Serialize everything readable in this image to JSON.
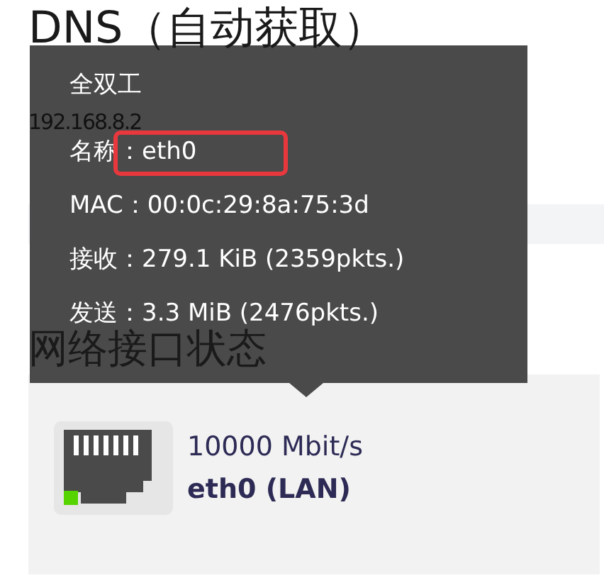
{
  "dns_heading": "DNS（自动获取）",
  "dns_value": "192.168.8.2",
  "section_heading": "网络接口状态",
  "tooltip": {
    "lines": [
      {
        "text": "全双工",
        "highlighted": false
      },
      {
        "text": "名称：eth0",
        "highlighted": true
      },
      {
        "text": "MAC：00:0c:29:8a:75:3d",
        "highlighted": false
      },
      {
        "text": "接收：279.1 KiB (2359pkts.)",
        "highlighted": false
      },
      {
        "text": "发送：3.3 MiB (2476pkts.)",
        "highlighted": false
      }
    ]
  },
  "interface": {
    "speed": "10000 Mbit/s",
    "name": "eth0 (LAN)",
    "link_up": true
  }
}
